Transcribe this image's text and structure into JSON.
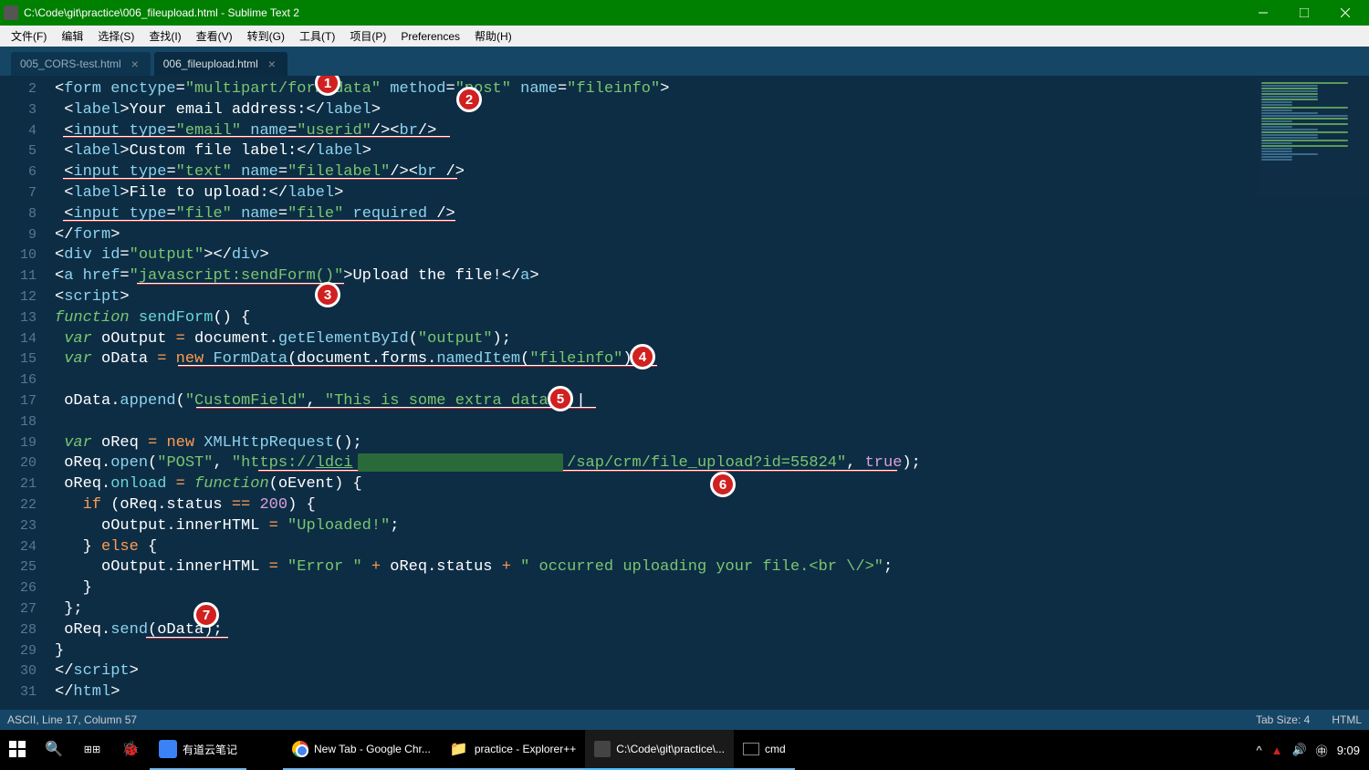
{
  "window": {
    "title": "C:\\Code\\git\\practice\\006_fileupload.html - Sublime Text 2"
  },
  "menu": {
    "file": "文件(F)",
    "edit": "编辑",
    "select": "选择(S)",
    "find": "查找(I)",
    "view": "查看(V)",
    "goto": "转到(G)",
    "tools": "工具(T)",
    "project": "项目(P)",
    "preferences": "Preferences",
    "help": "帮助(H)"
  },
  "tabs": {
    "t1": "005_CORS-test.html",
    "t2": "006_fileupload.html"
  },
  "gutter": {
    "l2": "2",
    "l3": "3",
    "l4": "4",
    "l5": "5",
    "l6": "6",
    "l7": "7",
    "l8": "8",
    "l9": "9",
    "l10": "10",
    "l11": "11",
    "l12": "12",
    "l13": "13",
    "l14": "14",
    "l15": "15",
    "l16": "16",
    "l17": "17",
    "l18": "18",
    "l19": "19",
    "l20": "20",
    "l21": "21",
    "l22": "22",
    "l23": "23",
    "l24": "24",
    "l25": "25",
    "l26": "26",
    "l27": "27",
    "l28": "28",
    "l29": "29",
    "l30": "30",
    "l31": "31"
  },
  "code": {
    "s2a": "multipart/form-data",
    "s2b": "post",
    "s2c": "fileinfo",
    "t3": "Your email address:",
    "s4a": "email",
    "s4b": "userid",
    "t5": "Custom file label:",
    "s6a": "text",
    "s6b": "filelabel",
    "t7": "File to upload:",
    "s8a": "file",
    "s8b": "file",
    "s10": "output",
    "s11a": "javascript:sendForm()",
    "t11": "Upload the file!",
    "fn13": "sendForm",
    "s14": "output",
    "s15": "fileinfo",
    "s17a": "CustomField",
    "s17b": "This is some extra data",
    "s20a": "POST",
    "s20b1": "https://",
    "s20b2": "ldci",
    "s20b3": "/sap/crm/file_upload?id=55824",
    "b20": "true",
    "n22": "200",
    "s23": "Uploaded!",
    "s25a": "Error ",
    "s25b": " occurred uploading your file.<br \\/>"
  },
  "annotations": {
    "a1": "1",
    "a2": "2",
    "a3": "3",
    "a4": "4",
    "a5": "5",
    "a6": "6",
    "a7": "7"
  },
  "status": {
    "left": "ASCII, Line 17, Column 57",
    "tabsize": "Tab Size: 4",
    "lang": "HTML"
  },
  "taskbar": {
    "youdao": "有道云笔记",
    "chrome": "New Tab - Google Chr...",
    "explorer": "practice - Explorer++",
    "sublime": "C:\\Code\\git\\practice\\...",
    "cmd": "cmd",
    "clock": "9:09"
  }
}
